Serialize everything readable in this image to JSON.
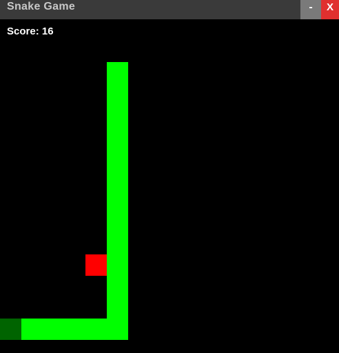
{
  "window": {
    "title": "Snake Game",
    "minimize_label": "-",
    "close_label": "X"
  },
  "hud": {
    "score_label": "Score:",
    "score_value": "16"
  },
  "colors": {
    "background": "#000000",
    "snake_body": "#00ff00",
    "snake_tail": "#006400",
    "food": "#ff0000",
    "titlebar": "#3a3a3a",
    "minimize": "#7a7a7a",
    "close": "#e0302f"
  },
  "game": {
    "grid_cell": "square",
    "snake": [
      {
        "col": 5,
        "row": 2,
        "part": "head"
      },
      {
        "col": 5,
        "row": 3,
        "part": "body"
      },
      {
        "col": 5,
        "row": 4,
        "part": "body"
      },
      {
        "col": 5,
        "row": 5,
        "part": "body"
      },
      {
        "col": 5,
        "row": 6,
        "part": "body"
      },
      {
        "col": 5,
        "row": 7,
        "part": "body"
      },
      {
        "col": 5,
        "row": 8,
        "part": "body"
      },
      {
        "col": 5,
        "row": 9,
        "part": "body"
      },
      {
        "col": 5,
        "row": 10,
        "part": "body"
      },
      {
        "col": 5,
        "row": 11,
        "part": "body"
      },
      {
        "col": 5,
        "row": 12,
        "part": "body"
      },
      {
        "col": 5,
        "row": 13,
        "part": "body"
      },
      {
        "col": 5,
        "row": 14,
        "part": "body"
      },
      {
        "col": 4,
        "row": 14,
        "part": "body"
      },
      {
        "col": 3,
        "row": 14,
        "part": "body"
      },
      {
        "col": 2,
        "row": 14,
        "part": "body"
      },
      {
        "col": 1,
        "row": 14,
        "part": "body"
      },
      {
        "col": 0,
        "row": 14,
        "part": "tail"
      }
    ],
    "food": {
      "col": 4,
      "row": 11
    }
  }
}
